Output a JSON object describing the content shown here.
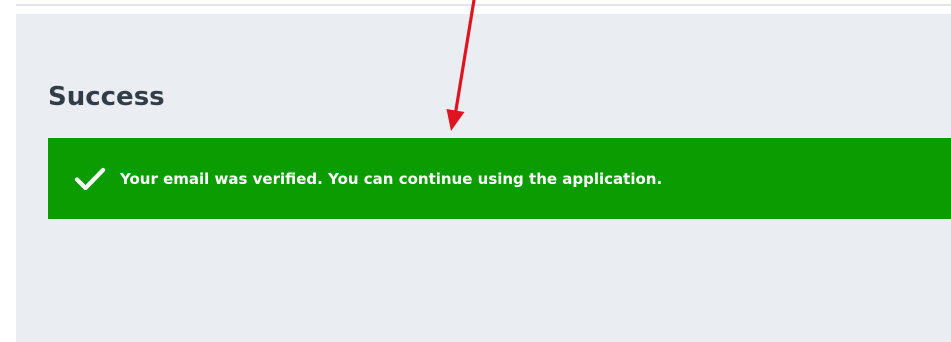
{
  "page": {
    "title": "Success"
  },
  "alert": {
    "message": "Your email was verified. You can continue using the application.",
    "icon": "check-icon",
    "type": "success"
  },
  "colors": {
    "panel_background": "#eaeef2",
    "success_green": "#0a9c00",
    "title_text": "#333c49",
    "annotation_arrow": "#e0141e"
  },
  "annotation": {
    "type": "arrow",
    "points_to": "alert"
  }
}
